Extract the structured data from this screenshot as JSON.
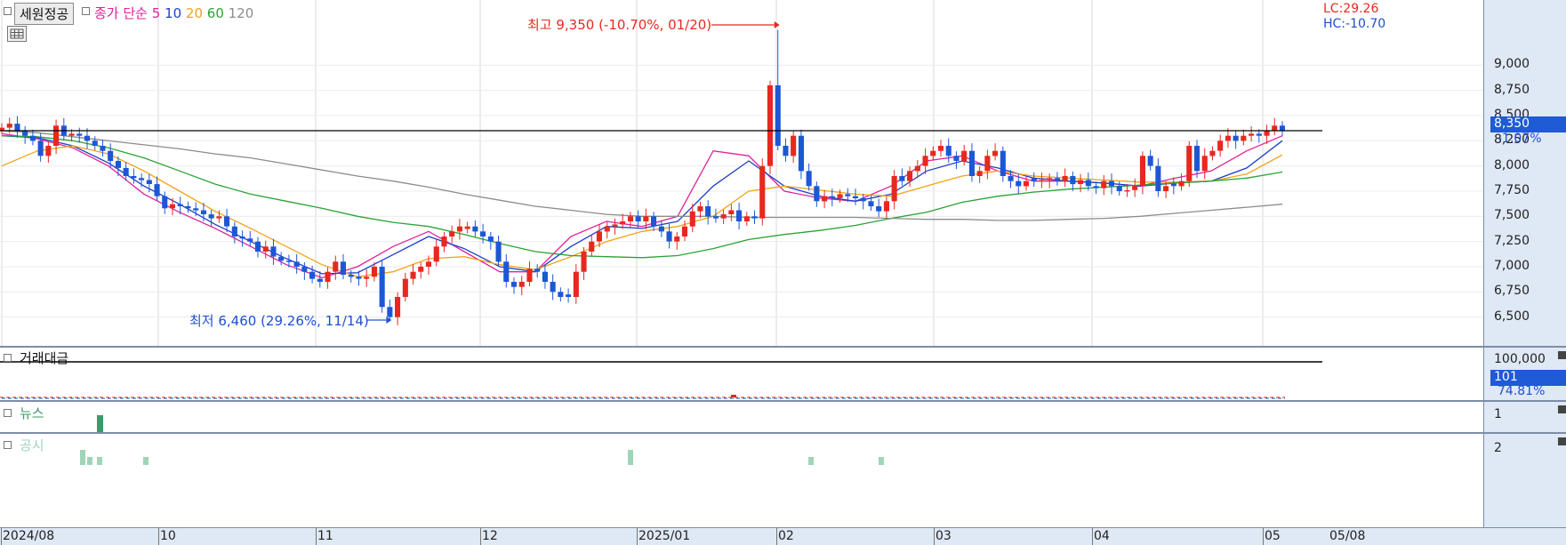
{
  "stock_name": "세원정공",
  "ma_title": "종가 단순",
  "ma_periods": [
    {
      "label": "5",
      "color": "#e0219a"
    },
    {
      "label": "10",
      "color": "#1f3fc8"
    },
    {
      "label": "20",
      "color": "#f0a318"
    },
    {
      "label": "60",
      "color": "#2aa336"
    },
    {
      "label": "120",
      "color": "#8c8c8c"
    }
  ],
  "right_info": {
    "lc": "LC:29.26",
    "hc": "HC:-10.70"
  },
  "price_axis": {
    "ticks": [
      "9,000",
      "8,750",
      "8,500",
      "8,250",
      "8,000",
      "7,750",
      "7,500",
      "7,250",
      "7,000",
      "6,750",
      "6,500"
    ],
    "current_price": "8,350",
    "current_change": "-1.07%"
  },
  "annotations": {
    "high": "최고 9,350 (-10.70%, 01/20)",
    "low": "최저 6,460 (29.26%, 11/14)"
  },
  "volume_panel": {
    "title": "거래대금",
    "axis_value": "100,000",
    "current_value": "101",
    "current_change": "74.81%"
  },
  "news_panel": {
    "title": "뉴스",
    "axis_value": "1"
  },
  "disclosure_panel": {
    "title": "공시",
    "axis_value": "2"
  },
  "x_labels": [
    "2024/08",
    "10",
    "11",
    "12",
    "2025/01",
    "02",
    "03",
    "04",
    "05",
    "05/08"
  ],
  "colors": {
    "up": "#e8281f",
    "down": "#1d57d6",
    "ref_line": "#000000",
    "axis_bg": "#dfe8f5"
  },
  "chart_data": {
    "type": "candlestick",
    "title": "세원정공",
    "date_range": [
      "2024/08",
      "2025/05/08"
    ],
    "ylim": [
      6250,
      9400
    ],
    "reference_price": 8350,
    "highest": {
      "price": 9350,
      "date": "01/20",
      "change": "-10.70%"
    },
    "lowest": {
      "price": 6460,
      "date": "11/14",
      "change": "29.26%"
    },
    "closes": [
      8380,
      8420,
      8350,
      8300,
      8250,
      8100,
      8200,
      8400,
      8300,
      8320,
      8300,
      8250,
      8200,
      8150,
      8050,
      7980,
      7900,
      7880,
      7860,
      7820,
      7700,
      7580,
      7620,
      7600,
      7580,
      7560,
      7520,
      7480,
      7500,
      7400,
      7300,
      7280,
      7250,
      7150,
      7200,
      7100,
      7060,
      7050,
      7000,
      6950,
      6880,
      6850,
      6950,
      7050,
      6920,
      6900,
      6880,
      6900,
      7000,
      6600,
      6500,
      6700,
      6880,
      6950,
      7000,
      7050,
      7200,
      7300,
      7350,
      7400,
      7400,
      7350,
      7300,
      7250,
      7050,
      6850,
      6800,
      6850,
      6980,
      6950,
      6850,
      6750,
      6700,
      6700,
      6950,
      7150,
      7250,
      7350,
      7400,
      7420,
      7450,
      7500,
      7450,
      7500,
      7400,
      7350,
      7250,
      7300,
      7400,
      7550,
      7600,
      7500,
      7480,
      7520,
      7560,
      7450,
      7500,
      7480,
      8000,
      8800,
      8200,
      8100,
      8300,
      7950,
      7800,
      7650,
      7700,
      7680,
      7720,
      7700,
      7680,
      7650,
      7600,
      7550,
      7650,
      7900,
      7850,
      7950,
      8000,
      8100,
      8150,
      8200,
      8100,
      8050,
      8150,
      7900,
      7950,
      8100,
      8150,
      7900,
      7850,
      7800,
      7850,
      7850,
      7860,
      7880,
      7850,
      7900,
      7820,
      7860,
      7800,
      7780,
      7850,
      7800,
      7750,
      7760,
      7800,
      8100,
      8000,
      7750,
      7800,
      7800,
      7850,
      8200,
      7950,
      8100,
      8150,
      8250,
      8300,
      8250,
      8300,
      8320,
      8300,
      8350,
      8400,
      8350
    ],
    "moving_averages": [
      {
        "name": "5",
        "values": [
          8320,
          8270,
          8180,
          8000,
          7720,
          7540,
          7380,
          7200,
          7020,
          6890,
          7000,
          7200,
          7350,
          7150,
          6950,
          6950,
          7300,
          7450,
          7400,
          7500,
          8150,
          8100,
          7750,
          7680,
          7650,
          7800,
          8050,
          8100,
          7950,
          7850,
          7850,
          7830,
          7800,
          7880,
          7950,
          8150,
          8300
        ]
      },
      {
        "name": "10",
        "values": [
          8300,
          8280,
          8200,
          8030,
          7800,
          7620,
          7420,
          7250,
          7080,
          6930,
          6940,
          7120,
          7300,
          7180,
          7000,
          6950,
          7200,
          7400,
          7380,
          7450,
          7800,
          8050,
          7800,
          7700,
          7650,
          7720,
          7950,
          8050,
          7980,
          7880,
          7850,
          7830,
          7800,
          7830,
          7850,
          7980,
          8250
        ]
      },
      {
        "name": "20",
        "values": [
          8000,
          8150,
          8200,
          8120,
          7950,
          7750,
          7550,
          7380,
          7200,
          7020,
          6900,
          6950,
          7080,
          7100,
          7020,
          6970,
          7100,
          7250,
          7350,
          7400,
          7500,
          7750,
          7800,
          7760,
          7720,
          7700,
          7800,
          7900,
          7950,
          7900,
          7880,
          7860,
          7840,
          7840,
          7850,
          7920,
          8110
        ]
      },
      {
        "name": "60",
        "values": [
          8300,
          8290,
          8250,
          8180,
          8080,
          7950,
          7820,
          7720,
          7650,
          7580,
          7500,
          7440,
          7400,
          7320,
          7230,
          7150,
          7110,
          7100,
          7090,
          7110,
          7180,
          7270,
          7320,
          7360,
          7410,
          7480,
          7540,
          7640,
          7700,
          7740,
          7770,
          7790,
          7810,
          7830,
          7850,
          7880,
          7940
        ]
      },
      {
        "name": "120",
        "values": [
          8350,
          8330,
          8290,
          8250,
          8210,
          8170,
          8120,
          8080,
          8020,
          7960,
          7900,
          7850,
          7790,
          7720,
          7660,
          7600,
          7560,
          7520,
          7500,
          7500,
          7500,
          7490,
          7490,
          7490,
          7490,
          7480,
          7470,
          7470,
          7460,
          7460,
          7470,
          7480,
          7500,
          7530,
          7560,
          7590,
          7620
        ]
      }
    ],
    "ylabel": "",
    "xlabel": ""
  }
}
